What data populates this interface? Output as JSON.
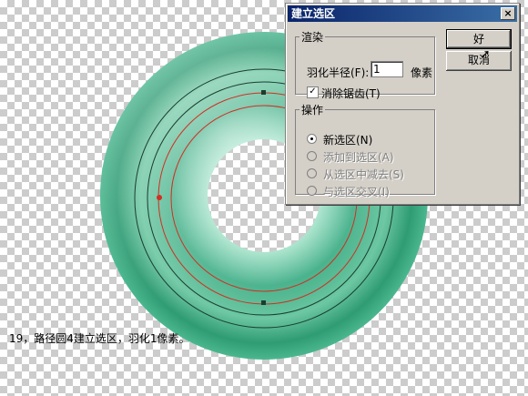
{
  "dialog": {
    "title": "建立选区",
    "close_label": "×",
    "render_group": {
      "legend": "渲染",
      "feather_label": "羽化半径(F):",
      "feather_value": "1",
      "feather_unit": "像素",
      "antialias_label": "消除锯齿(T)",
      "antialias_checked": true
    },
    "operation_group": {
      "legend": "操作",
      "options": [
        {
          "label": "新选区(N)",
          "selected": true,
          "enabled": true
        },
        {
          "label": "添加到选区(A)",
          "selected": false,
          "enabled": false
        },
        {
          "label": "从选区中减去(S)",
          "selected": false,
          "enabled": false
        },
        {
          "label": "与选区交叉(I)",
          "selected": false,
          "enabled": false
        }
      ]
    },
    "ok_label": "好",
    "cancel_label": "取消"
  },
  "caption": "19，路径圆4建立选区，羽化1像素。",
  "colors": {
    "ring": "#3fae86",
    "ring_light": "#c8eedd",
    "path_red": "#d03020",
    "path_dark": "#1a3d30"
  }
}
